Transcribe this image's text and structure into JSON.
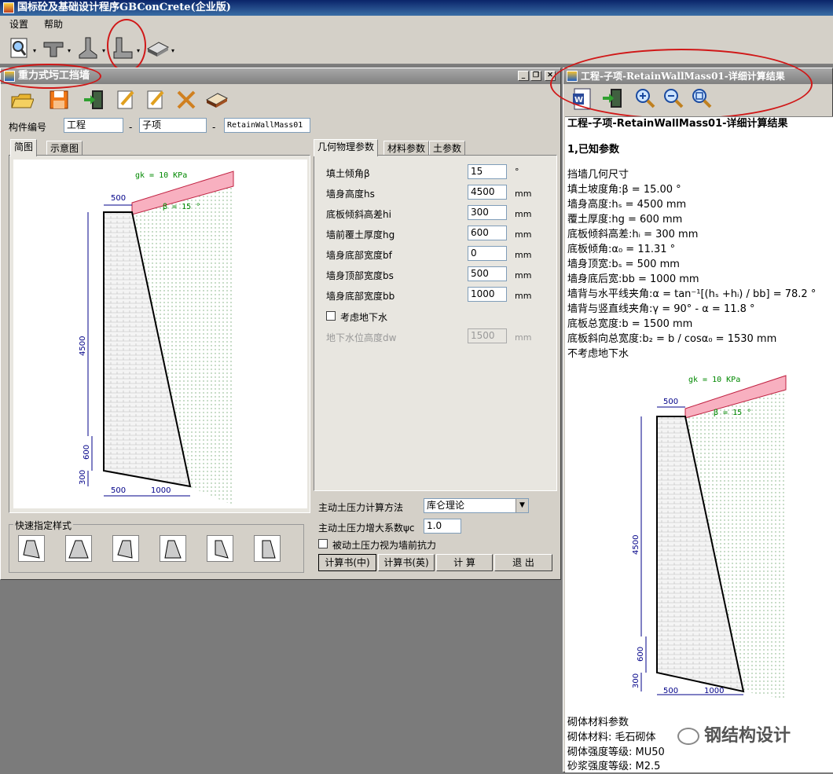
{
  "app": {
    "title": "国标砼及基础设计程序GBConCrete(企业版)"
  },
  "menu": [
    "设置",
    "帮助"
  ],
  "toolbar": {
    "icons": [
      "preview-icon",
      "beam-icon",
      "foundation-icon",
      "retaining-wall-icon",
      "book-icon"
    ]
  },
  "leftWin": {
    "title": "重力式圬工挡墙",
    "id_label": "构件编号",
    "id1": "工程",
    "id2": "子项",
    "id3": "RetainWallMass01",
    "sep": "-",
    "tabs": [
      "简图",
      "示意图"
    ],
    "param_tabs": [
      "几何物理参数",
      "材料参数",
      "土参数"
    ],
    "params": [
      {
        "label": "填土倾角β",
        "value": "15",
        "unit": "°"
      },
      {
        "label": "墙身高度hs",
        "value": "4500",
        "unit": "mm"
      },
      {
        "label": "底板倾斜高差hi",
        "value": "300",
        "unit": "mm"
      },
      {
        "label": "墙前覆土厚度hg",
        "value": "600",
        "unit": "mm"
      },
      {
        "label": "墙身底部宽度bf",
        "value": "0",
        "unit": "mm"
      },
      {
        "label": "墙身顶部宽度bs",
        "value": "500",
        "unit": "mm"
      },
      {
        "label": "墙身底部宽度bb",
        "value": "1000",
        "unit": "mm"
      }
    ],
    "gw_check": "考虑地下水",
    "gw_label": "地下水位高度dw",
    "gw_value": "1500",
    "gw_unit": "mm",
    "method_label": "主动土压力计算方法",
    "method_value": "库仑理论",
    "factor_label": "主动土压力增大系数ψc",
    "factor_value": "1.0",
    "passive_check": "被动土压力视为墙前抗力",
    "buttons": [
      "计算书(中)",
      "计算书(英)",
      "计 算",
      "退 出"
    ],
    "quick_title": "快速指定样式",
    "sketch": {
      "gk": "gk = 10 KPa",
      "beta": "β = 15 °",
      "top": "500",
      "height": "4500",
      "hg": "600",
      "hi": "300",
      "b1": "500",
      "b2": "1000"
    }
  },
  "rightWin": {
    "title": "工程-子项-RetainWallMass01-详细计算结果",
    "heading": "工程-子项-RetainWallMass01-详细计算结果",
    "section1": "1,已知参数",
    "lines": [
      "挡墙几何尺寸",
      "填土坡度角:β = 15.00 °",
      "墙身高度:hₛ = 4500 mm",
      "覆土厚度:hg = 600 mm",
      "底板倾斜高差:hᵢ = 300 mm",
      "底板倾角:α₀ = 11.31 °",
      "墙身顶宽:bₛ = 500 mm",
      "墙身底后宽:bb = 1000 mm",
      "墙背与水平线夹角:α = tan⁻¹[(hₛ +hᵢ) / bb] = 78.2 °",
      "墙背与竖直线夹角:γ = 90° - α = 11.8 °",
      "底板总宽度:b = 1500 mm",
      "底板斜向总宽度:b₂ = b / cosα₀ = 1530 mm",
      "不考虑地下水"
    ],
    "material_lines": [
      "砌体材料参数",
      "砌体材料: 毛石砌体",
      "砌体强度等级: MU50",
      "砂浆强度等级: M2.5"
    ]
  },
  "watermark": "钢结构设计"
}
